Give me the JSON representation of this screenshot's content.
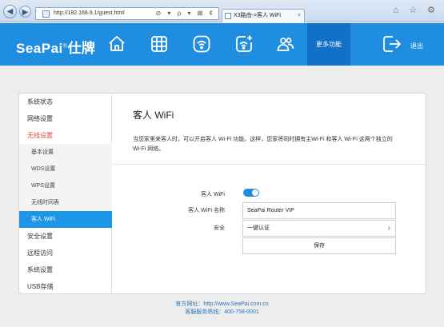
{
  "browser": {
    "url": "http://192.168.9.1/guest.html",
    "tab_title": "X3路由->客人 WiFi",
    "tools_glyphs": "⊘ ▾ ρ ▾ ⊠ ¢",
    "window_glyphs": "⌂ ☆ ⚙"
  },
  "header": {
    "brand": "SeaPai",
    "brand_cn": "仕牌",
    "brand_mark": "®",
    "more_label": "更多功能",
    "logout_label": "退出",
    "nav_icons": [
      "home-icon",
      "grid-icon",
      "wifi-icon",
      "add-wifi-icon",
      "users-icon"
    ],
    "accent": "#1f8ee0"
  },
  "sidebar": {
    "items": [
      {
        "label": "系统状态"
      },
      {
        "label": "网络设置"
      },
      {
        "label": "无线设置"
      },
      {
        "label": "基本设置"
      },
      {
        "label": "WDS设置"
      },
      {
        "label": "WPS设置"
      },
      {
        "label": "无线时间表"
      },
      {
        "label": "客人 WiFi"
      },
      {
        "label": "安全设置"
      },
      {
        "label": "远程访问"
      },
      {
        "label": "系统设置"
      },
      {
        "label": "USB存储"
      }
    ]
  },
  "main": {
    "title": "客人 WiFi",
    "description": "当您家里来客人时，可以开启客人 Wi-Fi 功能。这样，您家将同时拥有主Wi-Fi 和客人 Wi-Fi 这两个独立的 Wi-Fi 网络。",
    "form": {
      "guest_wifi_label": "客人 WiFi",
      "guest_wifi_on": true,
      "name_label": "客人 WiFi 名称",
      "name_value": "SeaPai Router VIP",
      "security_label": "安全",
      "security_value": "一键认证",
      "save_label": "保存"
    }
  },
  "footer": {
    "website": "官方网址：http://www.SeaPai.com.cn",
    "hotline": "客服服务热线：400-758-0001"
  }
}
